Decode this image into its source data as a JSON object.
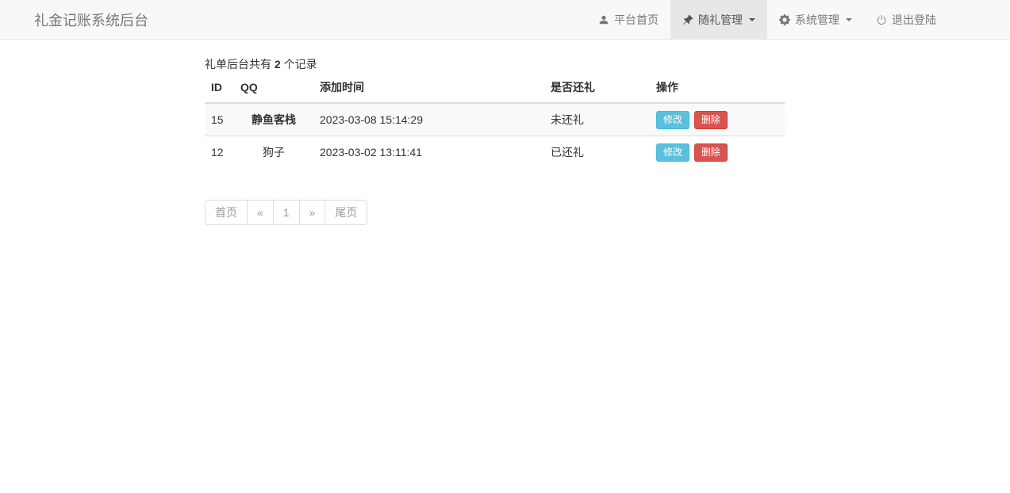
{
  "navbar": {
    "brand": "礼金记账系统后台",
    "items": [
      {
        "label": "平台首页",
        "icon": "user-icon",
        "active": false,
        "has_caret": false
      },
      {
        "label": "随礼管理",
        "icon": "pushpin-icon",
        "active": true,
        "has_caret": true
      },
      {
        "label": "系统管理",
        "icon": "gear-icon",
        "active": false,
        "has_caret": true
      },
      {
        "label": "退出登陆",
        "icon": "power-icon",
        "active": false,
        "has_caret": false
      }
    ]
  },
  "summary": {
    "prefix": "礼单后台共有",
    "count": "2",
    "suffix": "个记录"
  },
  "table": {
    "headers": [
      "ID",
      "QQ",
      "添加时间",
      "是否还礼",
      "操作"
    ],
    "rows": [
      {
        "id": "15",
        "qq": "静鱼客栈",
        "qq_bold": true,
        "added_time": "2023-03-08 15:14:29",
        "return_status": "未还礼",
        "edit_label": "修改",
        "delete_label": "删除"
      },
      {
        "id": "12",
        "qq": "狗子",
        "qq_bold": false,
        "added_time": "2023-03-02 13:11:41",
        "return_status": "已还礼",
        "edit_label": "修改",
        "delete_label": "删除"
      }
    ]
  },
  "pagination": {
    "items": [
      {
        "name": "pagination-first",
        "label": "首页"
      },
      {
        "name": "pagination-prev",
        "label": "«"
      },
      {
        "name": "pagination-page-1",
        "label": "1"
      },
      {
        "name": "pagination-next",
        "label": "»"
      },
      {
        "name": "pagination-last",
        "label": "尾页"
      }
    ]
  },
  "colors": {
    "info_button": "#5bc0de",
    "danger_button": "#d9534f",
    "navbar_bg": "#f8f8f8",
    "navbar_border": "#e7e7e7",
    "navbar_active_bg": "#e7e7e7",
    "stripe_row_bg": "#f9f9f9"
  }
}
